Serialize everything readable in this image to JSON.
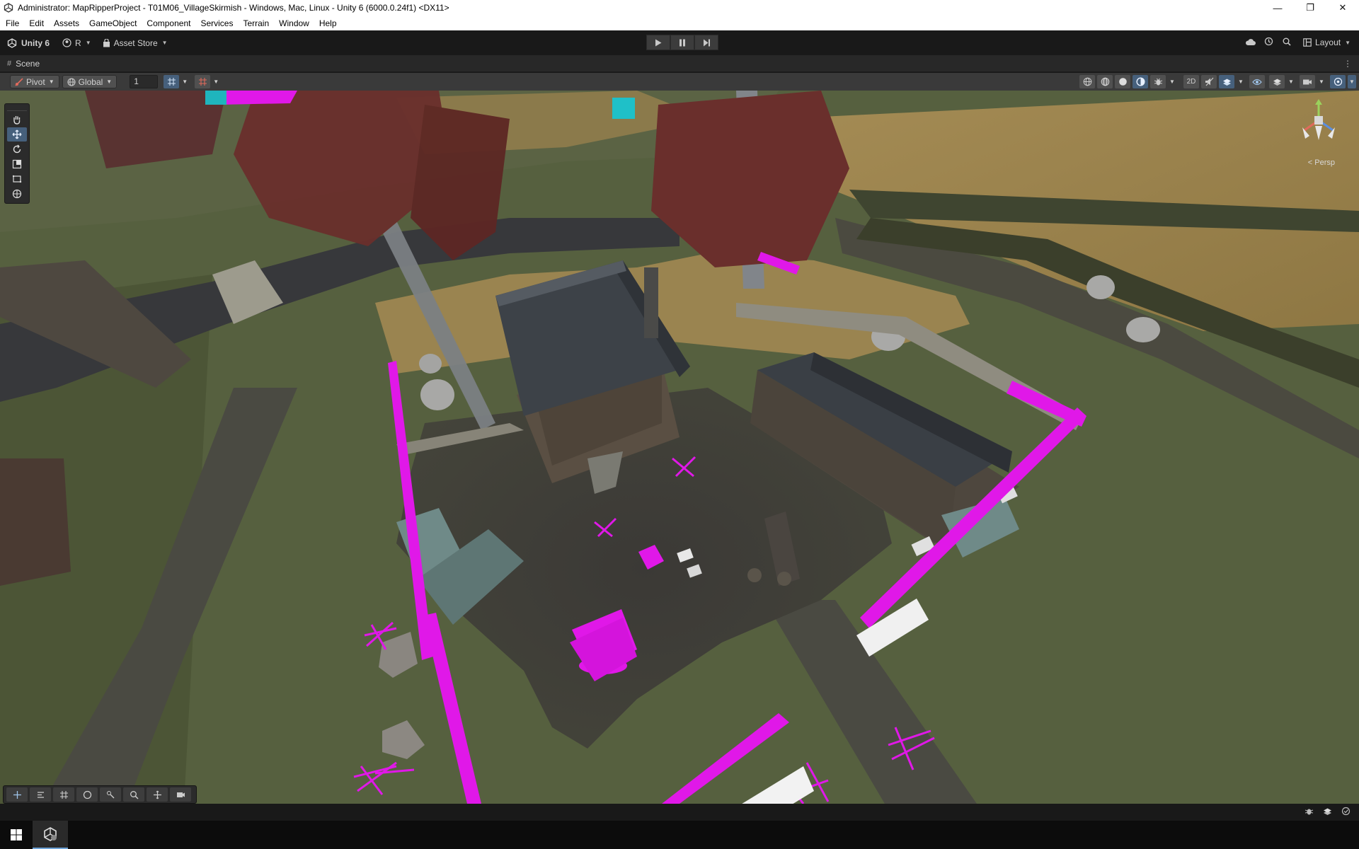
{
  "window": {
    "title": "Administrator: MapRipperProject - T01M06_VillageSkirmish - Windows, Mac, Linux - Unity 6 (6000.0.24f1) <DX11>",
    "minimize": "—",
    "restore": "❐",
    "close": "✕"
  },
  "menu": [
    "File",
    "Edit",
    "Assets",
    "GameObject",
    "Component",
    "Services",
    "Terrain",
    "Window",
    "Help"
  ],
  "toolbar": {
    "unity_label": "Unity 6",
    "account_label": "R",
    "asset_store_label": "Asset Store",
    "layout_label": "Layout"
  },
  "tabs": {
    "scene_label": "Scene"
  },
  "scene_toolbar": {
    "pivot_label": "Pivot",
    "global_label": "Global",
    "grid_increment": "1"
  },
  "viewport": {
    "projection_label": "< Persp",
    "colors": {
      "grass": "#56603f",
      "dirt": "#3a3836",
      "road": "#3a3a3d",
      "field": "#9a8450",
      "missing_material": "#e018e8",
      "roof": "#3d4248",
      "wall": "#5a4f43",
      "tent": "#6f8a88",
      "tree_foliage": "#6a2f2c"
    }
  },
  "icons": {
    "hand_tool": "hand-icon",
    "move_tool": "move-icon",
    "rotate_tool": "rotate-icon",
    "scale_tool": "scale-icon",
    "rect_tool": "rect-icon",
    "transform_tool": "transform-icon",
    "play": "play-icon",
    "pause": "pause-icon",
    "step": "step-icon"
  }
}
